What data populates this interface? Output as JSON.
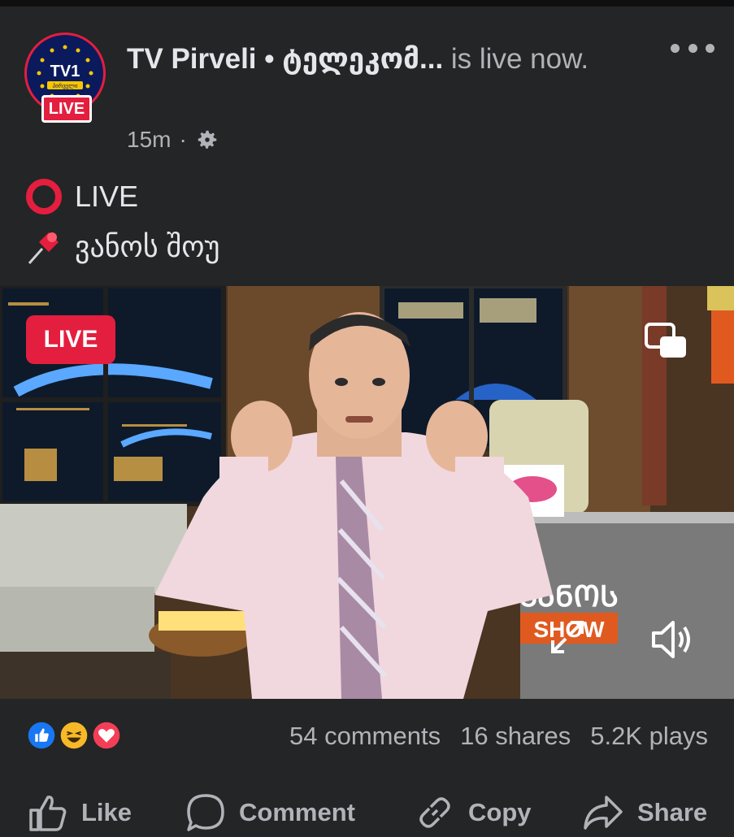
{
  "header": {
    "page_name": "TV Pirveli • ტელეკომ...",
    "status_text": " is live now.",
    "time": "15m",
    "separator": "·",
    "avatar_badge": "LIVE",
    "avatar_logo_text": "TV1",
    "avatar_logo_sub": "პირველი"
  },
  "caption": {
    "line1_icon": "⭕",
    "line1_text": "LIVE",
    "line2_icon": "📌",
    "line2_text": "ვანოს შოუ"
  },
  "video": {
    "live_badge": "LIVE",
    "show_logo_top": "ᲕᲐᲜᲝᲡ",
    "show_logo_bottom": "SHOW"
  },
  "stats": {
    "comments": "54 comments",
    "shares": "16 shares",
    "plays": "5.2K plays"
  },
  "actions": {
    "like": "Like",
    "comment": "Comment",
    "copy": "Copy",
    "share": "Share"
  },
  "colors": {
    "background": "#242526",
    "live_red": "#e41e3f",
    "text_primary": "#e4e6eb",
    "text_secondary": "#b0b3b8",
    "like_blue": "#1877f2",
    "haha_yellow": "#f7b928"
  },
  "icons": [
    "more-icon",
    "settings-gear-icon",
    "live-circle-icon",
    "pushpin-icon",
    "pip-icon",
    "expand-icon",
    "volume-icon",
    "like-reaction-icon",
    "haha-reaction-icon",
    "love-reaction-icon",
    "like-icon",
    "comment-icon",
    "copy-link-icon",
    "share-icon"
  ]
}
